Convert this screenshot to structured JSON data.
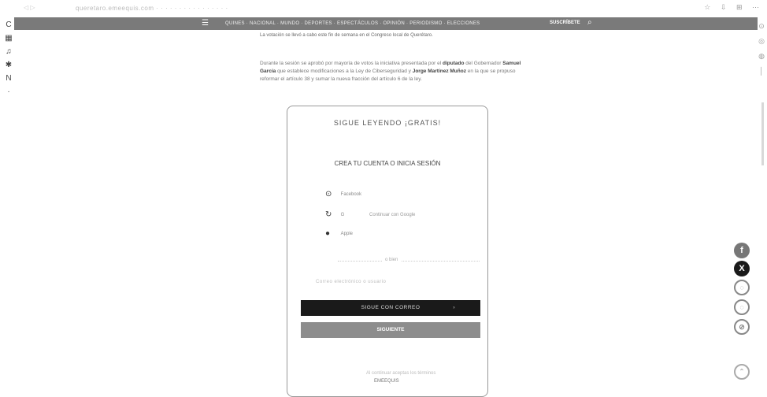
{
  "browser": {
    "nav_icons": "◁  ▷",
    "url": "queretaro.emeequis.com  ·  ·  ·  ·  ·  ·  ·  ·  ·  ·  ·  ·  ·  ·  ·  ·",
    "tools": [
      "☆",
      "⇩",
      "⊞",
      "⋯"
    ]
  },
  "left_toolbar": [
    "C",
    "▦",
    "♫",
    "✱",
    "N",
    "·"
  ],
  "right_toolbar": [
    "⊙",
    "◎",
    "◍",
    "│"
  ],
  "site_nav": {
    "menu_icon": "☰",
    "links": "QUINES · NACIONAL · MUNDO · DEPORTES · ESPECTÁCULOS · OPINIÓN · PERIODISMO · ELECCIONES",
    "subscribe": "SUSCRÍBETE",
    "search_icon": "⌕"
  },
  "article": {
    "caption": "La votación se llevó a cabo este fin de semana en el Congreso local de Querétaro.",
    "paragraph_lead": "Durante la sesión se aprobó por mayoría de votos la iniciativa presentada por el",
    "paragraph_bold_1": "diputado",
    "paragraph_mid": "del Gobernador",
    "paragraph_bold_2": "Samuel García",
    "paragraph_rest": "que establece modificaciones a la Ley de Ciberseguridad y",
    "paragraph_bold_3": "Jorge Martínez Muñoz",
    "paragraph_end": "en la que se propuso reformar el artículo 38 y sumar la nueva fracción del artículo 6 de la ley."
  },
  "modal": {
    "title": "SIGUE LEYENDO ¡GRATIS!",
    "subtitle": "CREA TU CUENTA O INICIA SESIÓN",
    "social": [
      {
        "icon": "⊙",
        "label": "Facebook",
        "extra": ""
      },
      {
        "icon": "G",
        "label": "G",
        "extra": "Continuar con Google"
      },
      {
        "icon": "",
        "label": "Apple",
        "extra": ""
      }
    ],
    "divider": "o bien",
    "email_hint": "Correo electrónico o usuario",
    "primary_button": "SIGUE CON CORREO",
    "primary_arrow": "›",
    "secondary_button": "SIGUIENTE",
    "fine_print": "Al continuar aceptas los términos",
    "bottom_link": "EMEEQUIS"
  },
  "share": {
    "facebook": "f",
    "x": "X",
    "whatsapp": "◌",
    "messenger": "◌",
    "link": "⊘",
    "to_top": "⌃"
  }
}
